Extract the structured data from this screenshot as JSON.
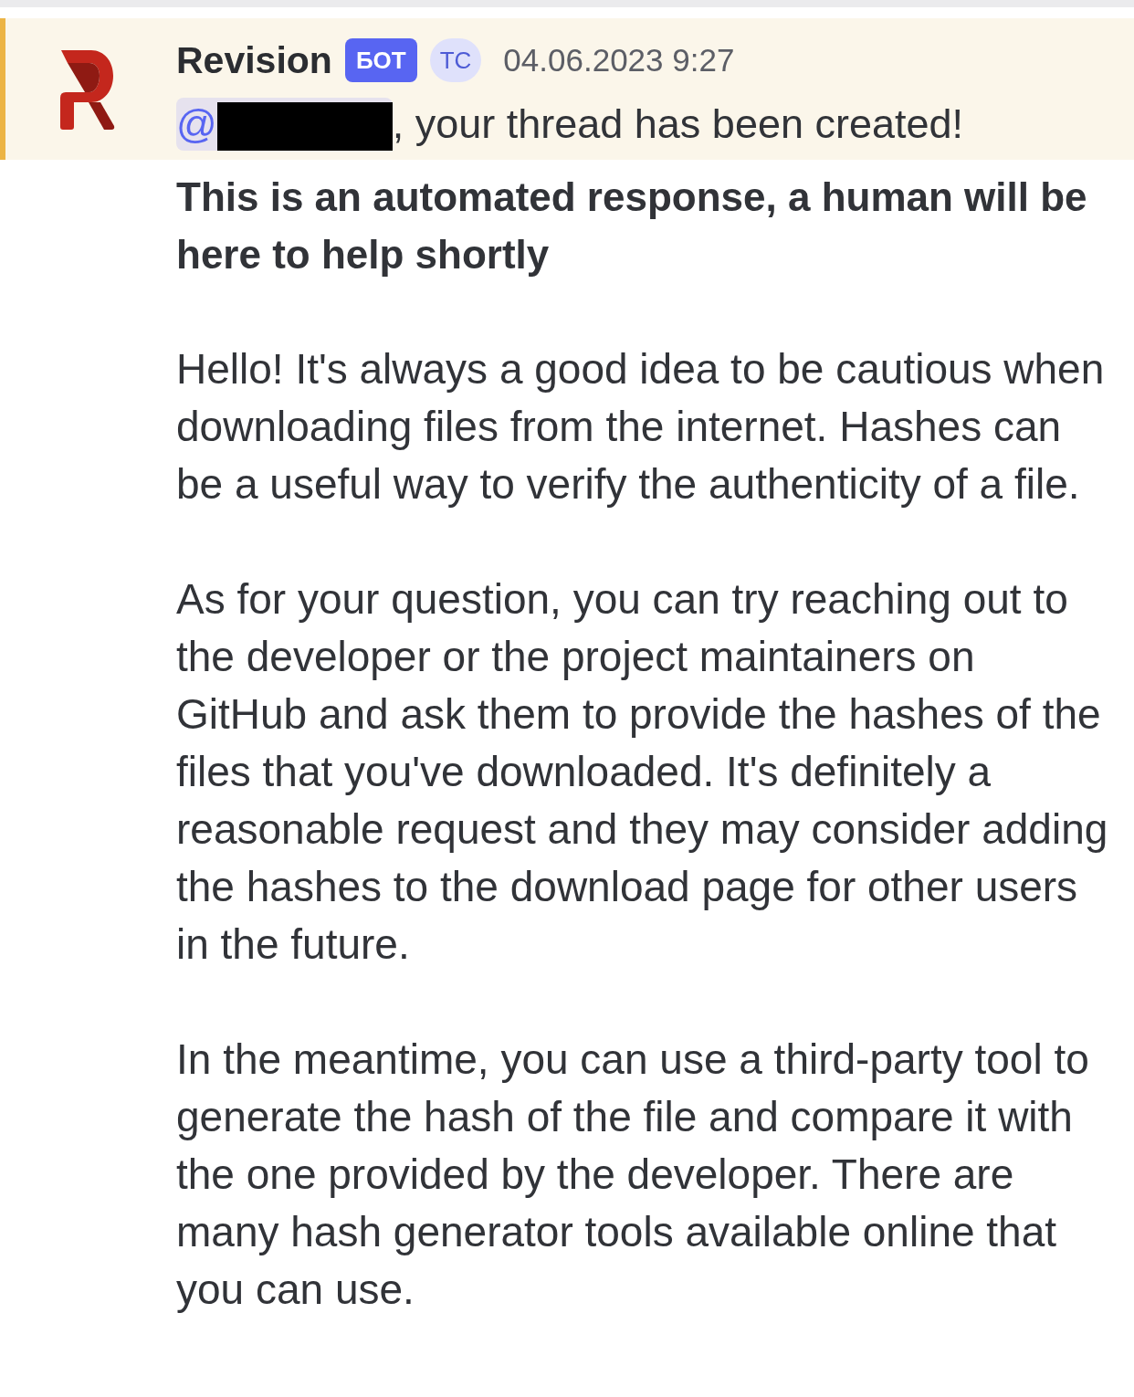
{
  "message": {
    "highlighted": true,
    "author": "Revision",
    "badges": [
      {
        "kind": "bot",
        "label": "БОТ"
      },
      {
        "kind": "op",
        "label": "ТС"
      }
    ],
    "timestamp": "04.06.2023 9:27",
    "mention": {
      "text": "@",
      "redacted": true
    },
    "mention_suffix": ", your thread has been created!",
    "body": [
      {
        "kind": "bold",
        "text": "This is an automated response, a human will be here to help shortly"
      },
      {
        "kind": "plain",
        "text": "Hello! It's always a good idea to be cautious when downloading files from the internet. Hashes can be a useful way to verify the authenticity of a file."
      },
      {
        "kind": "plain",
        "text": "As for your question, you can try reaching out to the developer or the project maintainers on GitHub and ask them to provide the hashes of the files that you've downloaded. It's definitely a reasonable request and they may consider adding the hashes to the download page for other users in the future."
      },
      {
        "kind": "plain",
        "text": "In the meantime, you can use a third-party tool to generate the hash of the file and compare it with the one provided by the developer. There are many hash generator tools available online that you can use."
      }
    ]
  }
}
